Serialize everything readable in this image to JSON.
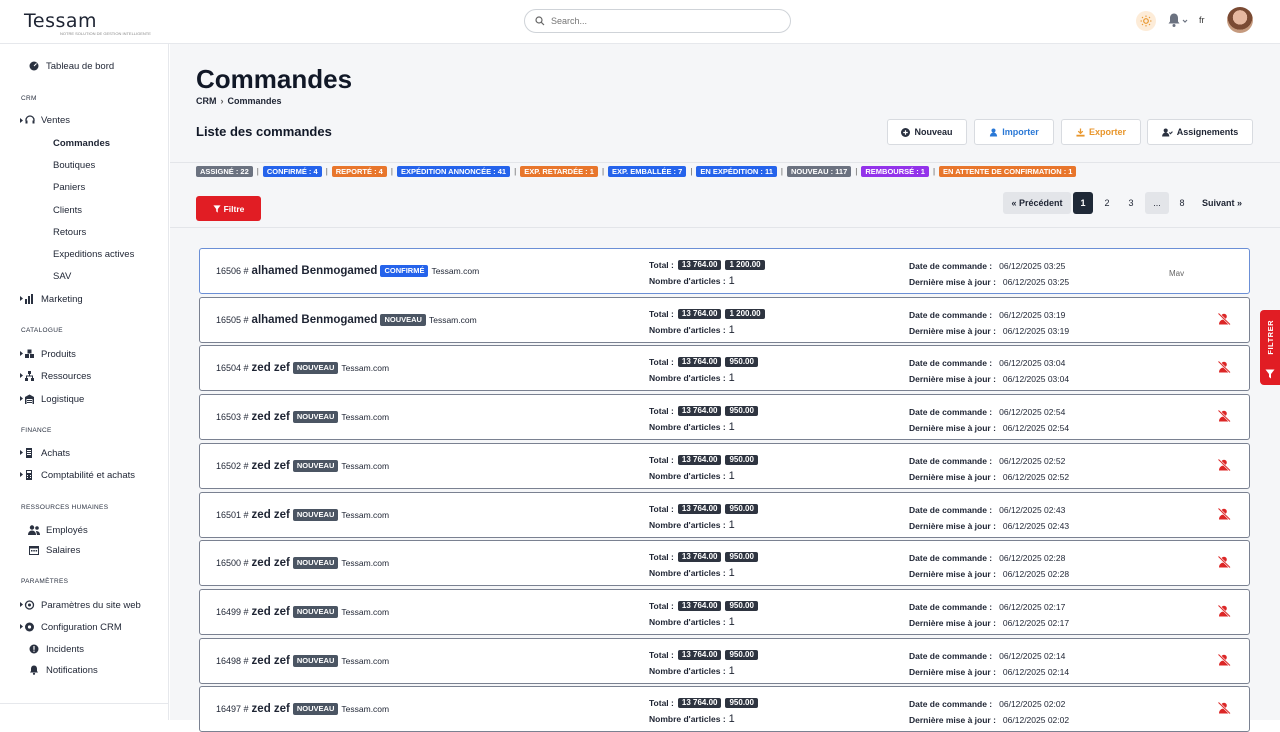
{
  "app": {
    "logo": "Tessam",
    "logo_tagline": "NOTRE SOLUTION DE GESTION INTELLIGENTE"
  },
  "topbar": {
    "search_placeholder": "Search...",
    "lang": "fr"
  },
  "sidebar": {
    "dashboard": "Tableau de bord",
    "sections": {
      "crm": "CRM",
      "catalogue": "CATALOGUE",
      "finance": "FINANCE",
      "rh": "RESSOURCES HUMAINES",
      "params": "PARAMÈTRES"
    },
    "ventes": "Ventes",
    "ventes_sub": [
      "Commandes",
      "Boutiques",
      "Paniers",
      "Clients",
      "Retours",
      "Expeditions actives",
      "SAV"
    ],
    "marketing": "Marketing",
    "produits": "Produits",
    "ressources": "Ressources",
    "logistique": "Logistique",
    "achats": "Achats",
    "compta": "Comptabilité et achats",
    "employes": "Employés",
    "salaires": "Salaires",
    "params_site": "Paramètres du site web",
    "config_crm": "Configuration CRM",
    "incidents": "Incidents",
    "notifications": "Notifications"
  },
  "page": {
    "title": "Commandes",
    "breadcrumb": [
      "CRM",
      "Commandes"
    ],
    "subtitle": "Liste des commandes",
    "buttons": {
      "nouveau": "Nouveau",
      "importer": "Importer",
      "exporter": "Exporter",
      "assignements": "Assignements"
    },
    "filter_label": "Filtre",
    "side_filter": "FILTRER"
  },
  "statuses": [
    {
      "label": "ASSIGNÉ : 22",
      "color": "#6b7280"
    },
    {
      "label": "CONFIRMÉ : 4",
      "color": "#2563eb"
    },
    {
      "label": "REPORTÉ : 4",
      "color": "#e8762c"
    },
    {
      "label": "EXPÉDITION ANNONCÉE : 41",
      "color": "#2563eb"
    },
    {
      "label": "EXP. RETARDÉE : 1",
      "color": "#e8762c"
    },
    {
      "label": "EXP. EMBALLÉE : 7",
      "color": "#2563eb"
    },
    {
      "label": "EN EXPÉDITION : 11",
      "color": "#2563eb"
    },
    {
      "label": "NOUVEAU : 117",
      "color": "#6b7280"
    },
    {
      "label": "REMBOURSÉ : 1",
      "color": "#9333ea"
    },
    {
      "label": "EN ATTENTE DE CONFIRMATION : 1",
      "color": "#e8762c"
    }
  ],
  "pagination": {
    "prev": "« Précédent",
    "pages": [
      "1",
      "2",
      "3",
      "...",
      "8"
    ],
    "current": "1",
    "next": "Suivant »"
  },
  "labels": {
    "total": "Total :",
    "nb_articles": "Nombre d'articles :",
    "date_cmd": "Date de commande :",
    "last_update": "Dernière mise à jour :"
  },
  "orders": [
    {
      "id": "16506 #",
      "name": "alhamed Benmogamed",
      "status": "CONFIRMÉ",
      "status_color": "#2563eb",
      "shop": "Tessam.com",
      "total": "13 764.00",
      "amount": "1 200.00",
      "count": "1",
      "date": "06/12/2025 03:25",
      "updated": "06/12/2025 03:25",
      "img_alt": "Mav"
    },
    {
      "id": "16505 #",
      "name": "alhamed Benmogamed",
      "status": "NOUVEAU",
      "status_color": "#4b5563",
      "shop": "Tessam.com",
      "total": "13 764.00",
      "amount": "1 200.00",
      "count": "1",
      "date": "06/12/2025 03:19",
      "updated": "06/12/2025 03:19"
    },
    {
      "id": "16504 #",
      "name": "zed zef",
      "status": "NOUVEAU",
      "status_color": "#4b5563",
      "shop": "Tessam.com",
      "total": "13 764.00",
      "amount": "950.00",
      "count": "1",
      "date": "06/12/2025 03:04",
      "updated": "06/12/2025 03:04"
    },
    {
      "id": "16503 #",
      "name": "zed zef",
      "status": "NOUVEAU",
      "status_color": "#4b5563",
      "shop": "Tessam.com",
      "total": "13 764.00",
      "amount": "950.00",
      "count": "1",
      "date": "06/12/2025 02:54",
      "updated": "06/12/2025 02:54"
    },
    {
      "id": "16502 #",
      "name": "zed zef",
      "status": "NOUVEAU",
      "status_color": "#4b5563",
      "shop": "Tessam.com",
      "total": "13 764.00",
      "amount": "950.00",
      "count": "1",
      "date": "06/12/2025 02:52",
      "updated": "06/12/2025 02:52"
    },
    {
      "id": "16501 #",
      "name": "zed zef",
      "status": "NOUVEAU",
      "status_color": "#4b5563",
      "shop": "Tessam.com",
      "total": "13 764.00",
      "amount": "950.00",
      "count": "1",
      "date": "06/12/2025 02:43",
      "updated": "06/12/2025 02:43"
    },
    {
      "id": "16500 #",
      "name": "zed zef",
      "status": "NOUVEAU",
      "status_color": "#4b5563",
      "shop": "Tessam.com",
      "total": "13 764.00",
      "amount": "950.00",
      "count": "1",
      "date": "06/12/2025 02:28",
      "updated": "06/12/2025 02:28"
    },
    {
      "id": "16499 #",
      "name": "zed zef",
      "status": "NOUVEAU",
      "status_color": "#4b5563",
      "shop": "Tessam.com",
      "total": "13 764.00",
      "amount": "950.00",
      "count": "1",
      "date": "06/12/2025 02:17",
      "updated": "06/12/2025 02:17"
    },
    {
      "id": "16498 #",
      "name": "zed zef",
      "status": "NOUVEAU",
      "status_color": "#4b5563",
      "shop": "Tessam.com",
      "total": "13 764.00",
      "amount": "950.00",
      "count": "1",
      "date": "06/12/2025 02:14",
      "updated": "06/12/2025 02:14"
    },
    {
      "id": "16497 #",
      "name": "zed zef",
      "status": "NOUVEAU",
      "status_color": "#4b5563",
      "shop": "Tessam.com",
      "total": "13 764.00",
      "amount": "950.00",
      "count": "1",
      "date": "06/12/2025 02:02",
      "updated": "06/12/2025 02:02"
    }
  ],
  "colors": {
    "accent_red": "#e11d24",
    "brand_blue": "#2563eb",
    "orange": "#e8762c"
  }
}
